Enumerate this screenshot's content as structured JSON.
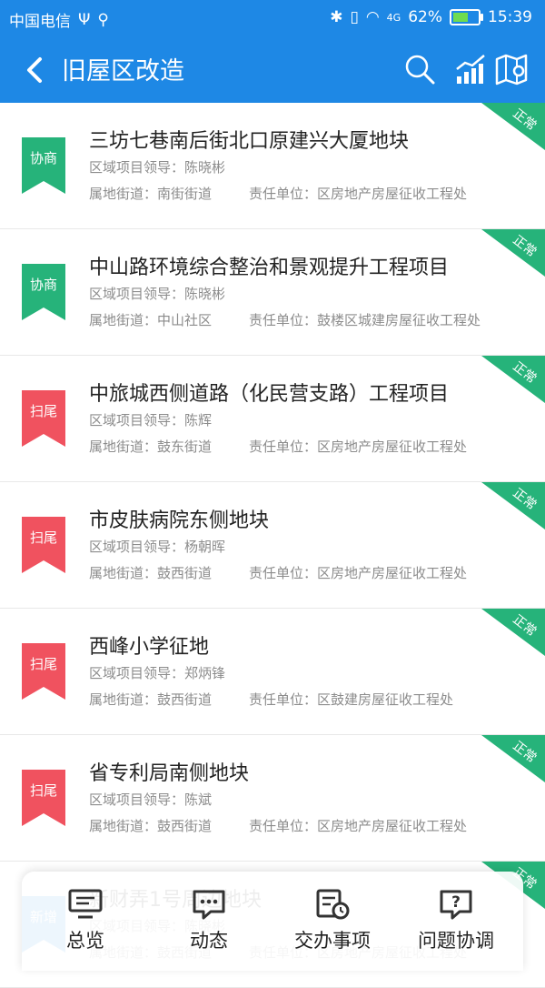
{
  "status": {
    "carrier": "中国电信",
    "battery": "62%",
    "time": "15:39"
  },
  "header": {
    "title": "旧屋区改造"
  },
  "items": [
    {
      "tag": "协商",
      "tag_color": "#26b37a",
      "name": "三坊七巷南后街北口原建兴大厦地块",
      "leader": "区域项目领导：陈晓彬",
      "street": "属地街道：南街街道",
      "unit": "责任单位：区房地产房屋征收工程处",
      "status": "正常"
    },
    {
      "tag": "协商",
      "tag_color": "#26b37a",
      "name": "中山路环境综合整治和景观提升工程项目",
      "leader": "区域项目领导：陈晓彬",
      "street": "属地街道：中山社区",
      "unit": "责任单位：鼓楼区城建房屋征收工程处",
      "status": "正常"
    },
    {
      "tag": "扫尾",
      "tag_color": "#f0525f",
      "name": "中旅城西侧道路（化民营支路）工程项目",
      "leader": "区域项目领导：陈辉",
      "street": "属地街道：鼓东街道",
      "unit": "责任单位：区房地产房屋征收工程处",
      "status": "正常"
    },
    {
      "tag": "扫尾",
      "tag_color": "#f0525f",
      "name": "市皮肤病院东侧地块",
      "leader": "区域项目领导：杨朝晖",
      "street": "属地街道：鼓西街道",
      "unit": "责任单位：区房地产房屋征收工程处",
      "status": "正常"
    },
    {
      "tag": "扫尾",
      "tag_color": "#f0525f",
      "name": "西峰小学征地",
      "leader": "区域项目领导：郑炳锋",
      "street": "属地街道：鼓西街道",
      "unit": "责任单位：区鼓建房屋征收工程处",
      "status": "正常"
    },
    {
      "tag": "扫尾",
      "tag_color": "#f0525f",
      "name": "省专利局南侧地块",
      "leader": "区域项目领导：陈斌",
      "street": "属地街道：鼓西街道",
      "unit": "责任单位：区房地产房屋征收工程处",
      "status": "正常"
    },
    {
      "tag": "新增",
      "tag_color": "#1e88e5",
      "name": "新财弄1号周边地块",
      "leader": "区域项目领导：陈晓彬",
      "street": "属地街道：鼓西街道",
      "unit": "责任单位：区房地产房屋征收工程处",
      "status": "正常"
    }
  ],
  "nav": {
    "overview": "总览",
    "dynamics": "动态",
    "tasks": "交办事项",
    "issues": "问题协调"
  },
  "colors": {
    "primary": "#1e88e5",
    "green": "#26b37a",
    "red": "#f0525f"
  }
}
